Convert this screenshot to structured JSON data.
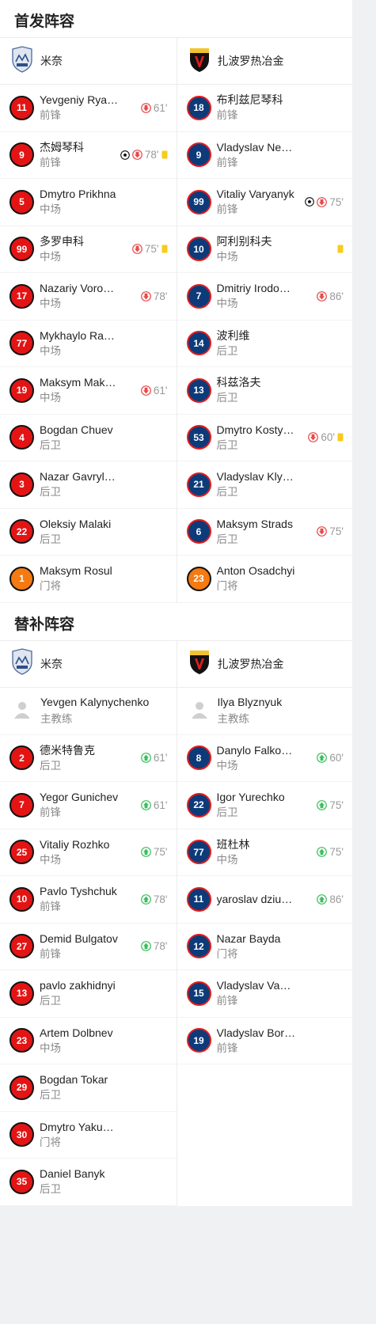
{
  "starting": {
    "title": "首发阵容",
    "home": {
      "name": "米奈",
      "players": [
        {
          "number": "11",
          "name": "Yevgeniy Ryazantsev",
          "position": "前锋",
          "events": [
            {
              "type": "sub-out",
              "minute": "61'"
            }
          ]
        },
        {
          "number": "9",
          "name": "杰姆琴科",
          "position": "前锋",
          "events": [
            {
              "type": "goal"
            },
            {
              "type": "sub-out",
              "minute": "78'"
            },
            {
              "type": "yellow"
            }
          ]
        },
        {
          "number": "5",
          "name": "Dmytro Prikhna",
          "position": "中场",
          "events": []
        },
        {
          "number": "99",
          "name": "多罗申科",
          "position": "中场",
          "events": [
            {
              "type": "sub-out",
              "minute": "75'"
            },
            {
              "type": "yellow"
            }
          ]
        },
        {
          "number": "17",
          "name": "Nazariy Vorobyov",
          "position": "中场",
          "events": [
            {
              "type": "sub-out",
              "minute": "78'"
            }
          ]
        },
        {
          "number": "77",
          "name": "Mykhaylo Ravlyuk",
          "position": "中场",
          "events": []
        },
        {
          "number": "19",
          "name": "Maksym Makarenko",
          "position": "中场",
          "events": [
            {
              "type": "sub-out",
              "minute": "61'"
            }
          ]
        },
        {
          "number": "4",
          "name": "Bogdan Chuev",
          "position": "后卫",
          "events": []
        },
        {
          "number": "3",
          "name": "Nazar Gavrylyuk",
          "position": "后卫",
          "events": []
        },
        {
          "number": "22",
          "name": "Oleksiy Malaki",
          "position": "后卫",
          "events": []
        },
        {
          "number": "1",
          "name": "Maksym Rosul",
          "position": "门将",
          "events": [],
          "gk": true
        }
      ]
    },
    "away": {
      "name": "扎波罗热冶金",
      "players": [
        {
          "number": "18",
          "name": "布利兹尼琴科",
          "position": "前锋",
          "events": []
        },
        {
          "number": "9",
          "name": "Vladyslav Nekhtiy",
          "position": "前锋",
          "events": []
        },
        {
          "number": "99",
          "name": "Vitaliy Varyanyk",
          "position": "前锋",
          "events": [
            {
              "type": "goal"
            },
            {
              "type": "sub-out",
              "minute": "75'"
            }
          ]
        },
        {
          "number": "10",
          "name": "阿利别科夫",
          "position": "中场",
          "events": [
            {
              "type": "yellow"
            }
          ]
        },
        {
          "number": "7",
          "name": "Dmitriy Irodovskiy",
          "position": "中场",
          "events": [
            {
              "type": "sub-out",
              "minute": "86'"
            }
          ]
        },
        {
          "number": "14",
          "name": "波利维",
          "position": "后卫",
          "events": []
        },
        {
          "number": "13",
          "name": "科兹洛夫",
          "position": "后卫",
          "events": []
        },
        {
          "number": "53",
          "name": "Dmytro Kostyshyn",
          "position": "后卫",
          "events": [
            {
              "type": "sub-out",
              "minute": "60'"
            },
            {
              "type": "yellow"
            }
          ]
        },
        {
          "number": "21",
          "name": "Vladyslav Klymenko",
          "position": "后卫",
          "events": []
        },
        {
          "number": "6",
          "name": "Maksym Strads",
          "position": "后卫",
          "events": [
            {
              "type": "sub-out",
              "minute": "75'"
            }
          ]
        },
        {
          "number": "23",
          "name": "Anton Osadchyi",
          "position": "门将",
          "events": [],
          "gk": true
        }
      ]
    }
  },
  "subs": {
    "title": "替补阵容",
    "home": {
      "name": "米奈",
      "coach": {
        "name": "Yevgen Kalynychenko",
        "role": "主教练"
      },
      "players": [
        {
          "number": "2",
          "name": "德米特鲁克",
          "position": "后卫",
          "events": [
            {
              "type": "sub-in",
              "minute": "61'"
            }
          ]
        },
        {
          "number": "7",
          "name": "Yegor Gunichev",
          "position": "前锋",
          "events": [
            {
              "type": "sub-in",
              "minute": "61'"
            }
          ]
        },
        {
          "number": "25",
          "name": "Vitaliy Rozhko",
          "position": "中场",
          "events": [
            {
              "type": "sub-in",
              "minute": "75'"
            }
          ]
        },
        {
          "number": "10",
          "name": "Pavlo Tyshchuk",
          "position": "前锋",
          "events": [
            {
              "type": "sub-in",
              "minute": "78'"
            }
          ]
        },
        {
          "number": "27",
          "name": "Demid Bulgatov",
          "position": "前锋",
          "events": [
            {
              "type": "sub-in",
              "minute": "78'"
            }
          ]
        },
        {
          "number": "13",
          "name": "pavlo zakhidnyi",
          "position": "后卫",
          "events": []
        },
        {
          "number": "23",
          "name": "Artem Dolbnev",
          "position": "中场",
          "events": []
        },
        {
          "number": "29",
          "name": "Bogdan Tokar",
          "position": "后卫",
          "events": []
        },
        {
          "number": "30",
          "name": "Dmytro Yakushenko",
          "position": "门将",
          "events": []
        },
        {
          "number": "35",
          "name": "Daniel Banyk",
          "position": "后卫",
          "events": []
        }
      ]
    },
    "away": {
      "name": "扎波罗热冶金",
      "coach": {
        "name": "Ilya Blyznyuk",
        "role": "主教练"
      },
      "players": [
        {
          "number": "8",
          "name": "Danylo Falkovskyi",
          "position": "中场",
          "events": [
            {
              "type": "sub-in",
              "minute": "60'"
            }
          ]
        },
        {
          "number": "22",
          "name": "Igor Yurechko",
          "position": "后卫",
          "events": [
            {
              "type": "sub-in",
              "minute": "75'"
            }
          ]
        },
        {
          "number": "77",
          "name": "班杜林",
          "position": "中场",
          "events": [
            {
              "type": "sub-in",
              "minute": "75'"
            }
          ]
        },
        {
          "number": "11",
          "name": "yaroslav dziubenko",
          "position": "",
          "events": [
            {
              "type": "sub-in",
              "minute": "86'"
            }
          ]
        },
        {
          "number": "12",
          "name": "Nazar Bayda",
          "position": "门将",
          "events": []
        },
        {
          "number": "15",
          "name": "Vladyslav Vakula",
          "position": "前锋",
          "events": []
        },
        {
          "number": "19",
          "name": "Vladyslav Borodai",
          "position": "前锋",
          "events": []
        }
      ]
    }
  },
  "icons": {
    "home_logo": "mynai-crest-icon",
    "away_logo": "metalurh-crest-icon",
    "coach": "person-silhouette-icon"
  },
  "colors": {
    "home_number_bg": "#e41414",
    "away_number_bg": "#0d3b7a",
    "goalkeeper_bg": "#f47a11",
    "sub_out": "#e84a4a",
    "sub_in": "#3cbf5c",
    "yellow_card": "#f7cc1a"
  }
}
